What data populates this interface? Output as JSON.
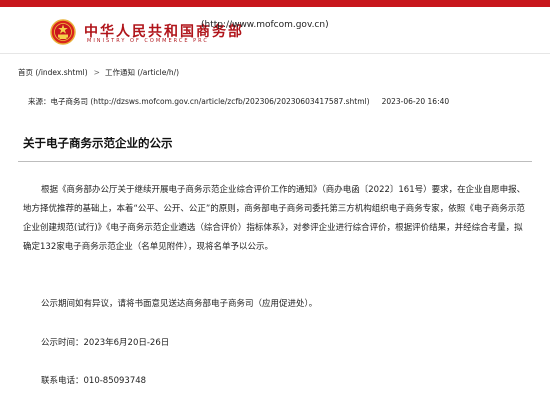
{
  "header": {
    "site_title": "中华人民共和国商务部",
    "site_url": "(http://www.mofcom.gov.cn)",
    "site_en": "MINISTRY OF COMMERCE PRC",
    "brand_color": "#c8161d",
    "emblem_icon": "national-emblem-icon"
  },
  "breadcrumb": {
    "home": "首页 (/index.shtml)",
    "separator": ">",
    "section": "工作通知 (/article/h/)"
  },
  "source": {
    "text": "来源：电子商务司 (http://dzsws.mofcom.gov.cn/article/zcfb/202306/20230603417587.shtml)",
    "date": "2023-06-20 16:40"
  },
  "article": {
    "title": "关于电子商务示范企业的公示",
    "paragraph1": "根据《商务部办公厅关于继续开展电子商务示范企业综合评价工作的通知》（商办电函〔2022〕161号）要求，在企业自愿申报、地方择优推荐的基础上，本着“公平、公开、公正”的原则，商务部电子商务司委托第三方机构组织电子商务专家，依照《电子商务示范企业创建规范(试行)》《电子商务示范企业遴选（综合评价）指标体系》，对参评企业进行综合评价，根据评价结果，并经综合考量，拟确定132家电子商务示范企业（名单见附件），现将名单予以公示。",
    "paragraph2": "公示期间如有异议，请将书面意见送达商务部电子商务司（应用促进处）。",
    "period": "公示时间：2023年6月20日-26日",
    "phone": "联系电话：010-85093748"
  }
}
